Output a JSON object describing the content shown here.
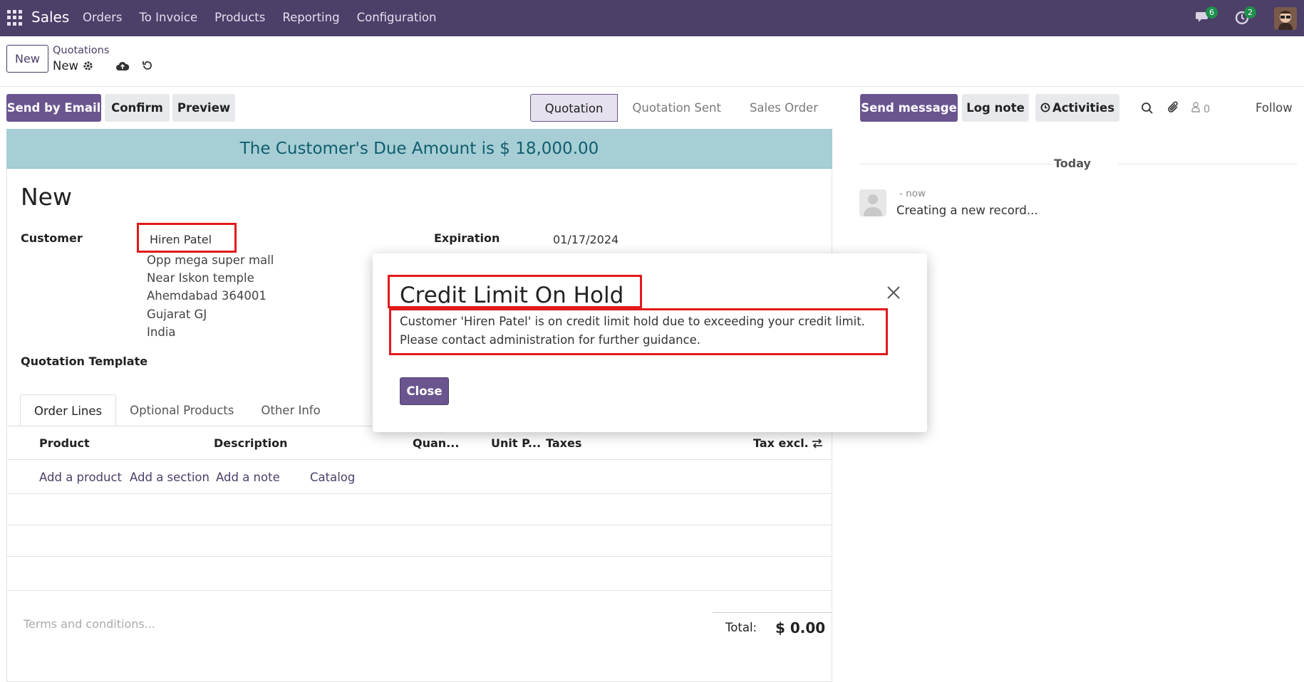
{
  "navbar": {
    "app_name": "Sales",
    "menu": [
      "Orders",
      "To Invoice",
      "Products",
      "Reporting",
      "Configuration"
    ],
    "messages_count": "6",
    "activities_count": "2"
  },
  "control": {
    "new_label": "New",
    "breadcrumb_parent": "Quotations",
    "breadcrumb_current": "New"
  },
  "actions": {
    "send_email": "Send by Email",
    "confirm": "Confirm",
    "preview": "Preview"
  },
  "stages": [
    "Quotation",
    "Quotation Sent",
    "Sales Order"
  ],
  "banner": "The Customer's Due Amount is $ 18,000.00",
  "record": {
    "title": "New",
    "customer_label": "Customer",
    "customer_name": "Hiren Patel",
    "address": [
      "Opp mega super mall",
      "Near Iskon temple",
      "Ahemdabad 364001",
      "Gujarat GJ",
      "India"
    ],
    "expiration_label": "Expiration",
    "expiration_value": "01/17/2024",
    "template_label": "Quotation Template"
  },
  "tabs": [
    "Order Lines",
    "Optional Products",
    "Other Info"
  ],
  "table": {
    "headers": [
      "Product",
      "Description",
      "Quan...",
      "Unit P...",
      "Taxes",
      "Tax excl."
    ],
    "add_links": [
      "Add a product",
      "Add a section",
      "Add a note",
      "Catalog"
    ]
  },
  "footer": {
    "terms_placeholder": "Terms and conditions...",
    "total_label": "Total:",
    "total_value": "$ 0.00"
  },
  "chatter": {
    "send_message": "Send message",
    "log_note": "Log note",
    "activities": "Activities",
    "followers_count": "0",
    "follow": "Follow",
    "today": "Today",
    "msg_time": "- now",
    "msg_body": "Creating a new record..."
  },
  "modal": {
    "title": "Credit Limit On Hold",
    "body": "Customer 'Hiren Patel' is on credit limit hold due to exceeding your credit limit. Please contact administration for further guidance.",
    "close_label": "Close"
  },
  "colors": {
    "navbar": "#4c3f68",
    "primary": "#6a558f",
    "banner": "#a7cdd5",
    "highlight": "#e21a1a"
  }
}
